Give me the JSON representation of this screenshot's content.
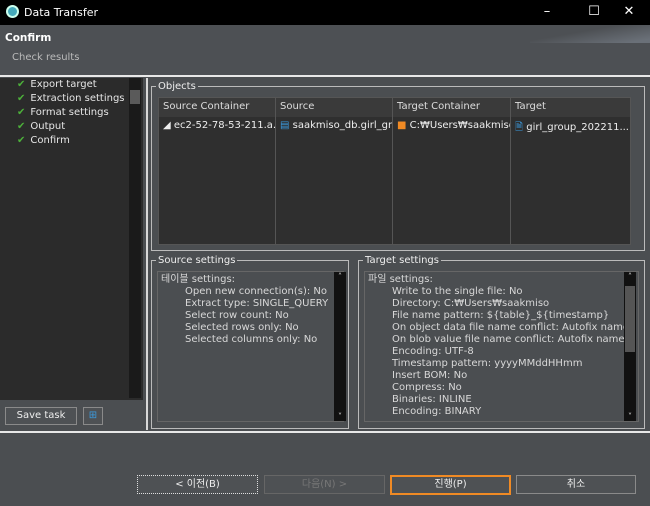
{
  "window": {
    "title": "Data Transfer"
  },
  "header": {
    "title": "Confirm",
    "subtitle": "Check results"
  },
  "steps": [
    "Export target",
    "Extraction settings",
    "Format settings",
    "Output",
    "Confirm"
  ],
  "left_buttons": {
    "save_task": "Save task"
  },
  "objects": {
    "legend": "Objects",
    "columns": [
      "Source Container",
      "Source",
      "Target Container",
      "Target"
    ],
    "row": [
      "ec2-52-78-53-211.a...",
      "saakmiso_db.girl_gr...",
      "C:₩Users₩saakmiso",
      "girl_group_202211..."
    ]
  },
  "source_settings": {
    "legend": "Source settings",
    "heading": "테이블 settings:",
    "lines": [
      "Open new connection(s): No",
      "Extract type: SINGLE_QUERY",
      "Select row count: No",
      "Selected rows only: No",
      "Selected columns only: No"
    ]
  },
  "target_settings": {
    "legend": "Target settings",
    "heading": "파일 settings:",
    "lines": [
      "Write to the single file: No",
      "Directory: C:₩Users₩saakmiso",
      "File name pattern: ${table}_${timestamp}",
      "On object data file name conflict: Autofix name",
      "On blob value file name conflict: Autofix name",
      "Encoding: UTF-8",
      "Timestamp pattern: yyyyMMddHHmm",
      "Insert BOM: No",
      "Compress: No",
      "Binaries: INLINE",
      "Encoding: BINARY"
    ]
  },
  "footer": {
    "back": "< 이전(B)",
    "next": "다음(N) >",
    "proceed": "진행(P)",
    "cancel": "취소"
  },
  "colors": {
    "accent": "#f08a24",
    "check": "#4caf3a"
  }
}
